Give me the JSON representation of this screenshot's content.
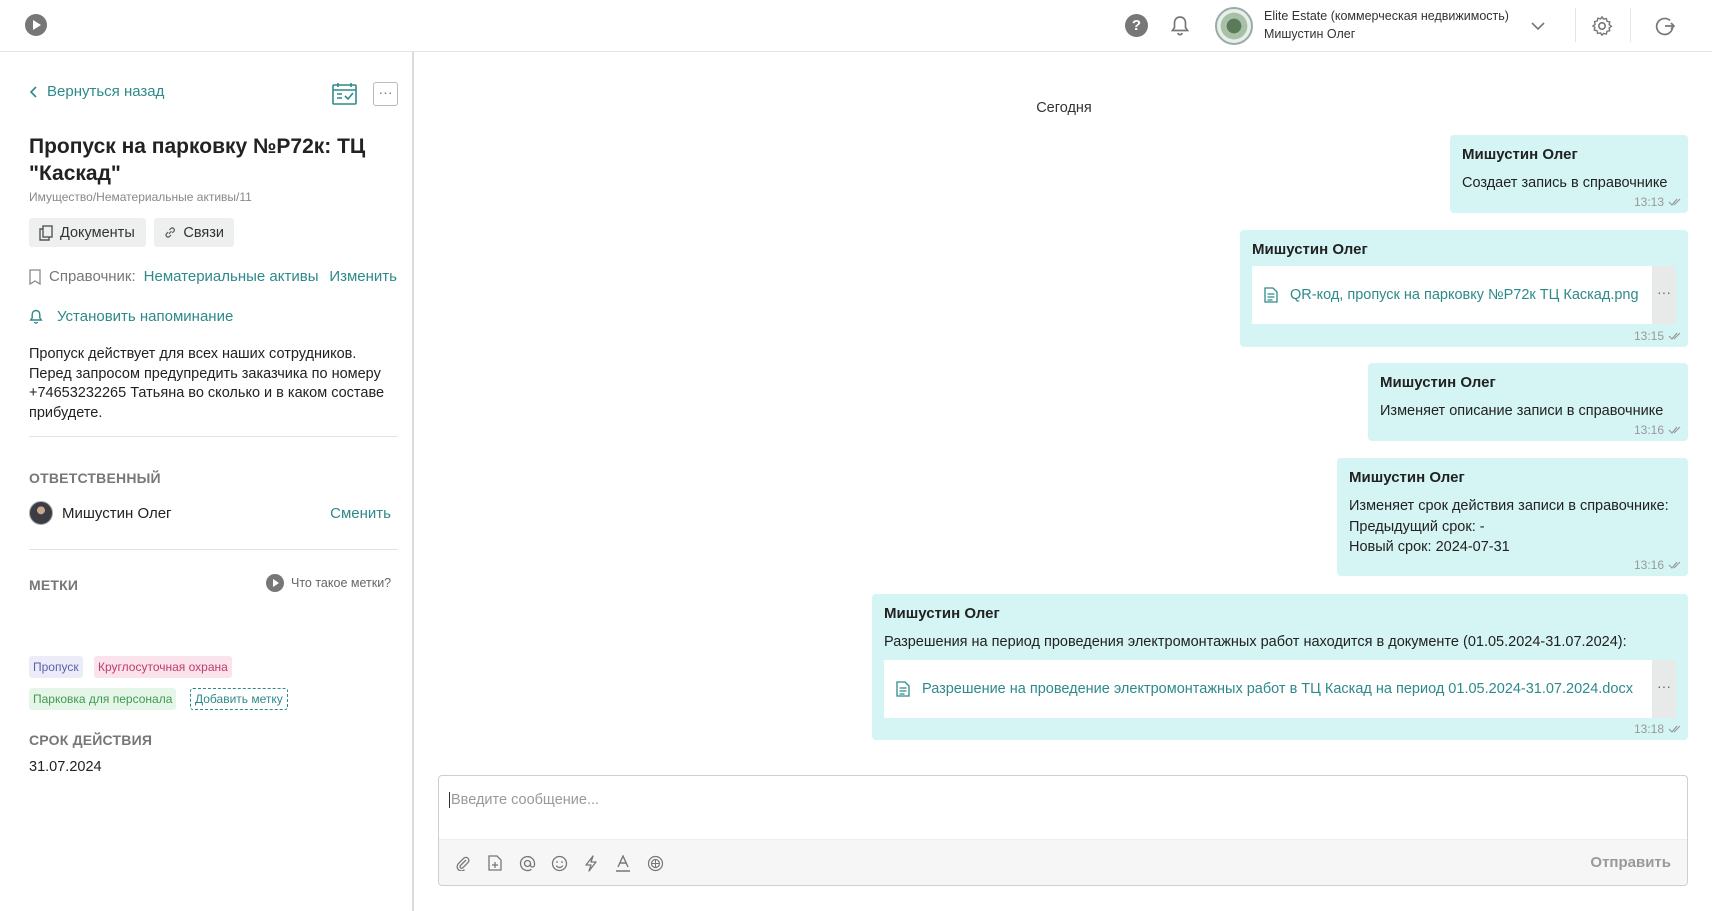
{
  "header": {
    "org_name": "Elite Estate (коммерческая недвижимость)",
    "user_name": "Мишустин Олег",
    "help_label": "?"
  },
  "left": {
    "back_label": "Вернуться назад",
    "more_label": "···",
    "title": "Пропуск на парковку №Р72к: ТЦ \"Каскад\"",
    "path": "Имущество/Нематериальные активы/11",
    "docs_label": "Документы",
    "links_label": "Связи",
    "directory_prefix": "Справочник:",
    "directory_name": "Нематериальные активы",
    "directory_change": "Изменить",
    "reminder_label": "Установить напоминание",
    "description": "Пропуск действует для всех наших сотрудников. Перед запросом предупредить заказчика по номеру +74653232265 Татьяна во сколько и в каком составе прибудете.",
    "responsible_title": "ОТВЕТСТВЕННЫЙ",
    "responsible_name": "Мишустин Олег",
    "responsible_change": "Сменить",
    "tags_title": "МЕТКИ",
    "what_tags_label": "Что такое метки?",
    "tags": [
      "Пропуск",
      "Круглосуточная охрана",
      "Парковка для персонала"
    ],
    "add_tag_label": "Добавить метку",
    "validity_title": "СРОК ДЕЙСТВИЯ",
    "validity_date": "31.07.2024"
  },
  "chat": {
    "day_label": "Сегодня",
    "messages": [
      {
        "author": "Мишустин Олег",
        "text": "Создает запись в справочнике",
        "time": "13:13"
      },
      {
        "author": "Мишустин Олег",
        "file": "QR-код, пропуск на парковку №Р72к ТЦ Каскад.png",
        "file_menu": "···",
        "time": "13:15"
      },
      {
        "author": "Мишустин Олег",
        "text": "Изменяет описание записи в справочнике",
        "time": "13:16"
      },
      {
        "author": "Мишустин Олег",
        "lines": [
          "Изменяет срок действия записи в справочнике:",
          "Предыдущий срок: -",
          "Новый срок: 2024-07-31"
        ],
        "time": "13:16"
      },
      {
        "author": "Мишустин Олег",
        "text": "Разрешения на период проведения электромонтажных работ находится в документе (01.05.2024-31.07.2024):",
        "file": "Разрешение на проведение электромонтажных работ в ТЦ Каскад на период 01.05.2024-31.07.2024.docx",
        "file_menu": "···",
        "time": "13:18"
      }
    ],
    "composer_placeholder": "Введите сообщение...",
    "send_label": "Отправить"
  },
  "colors": {
    "accent": "#2e8a8a",
    "bubble": "#d5f4f4"
  }
}
